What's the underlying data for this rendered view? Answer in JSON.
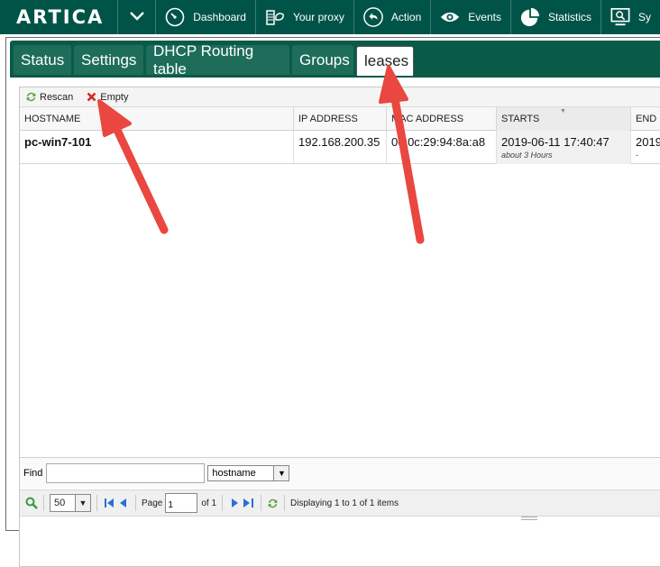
{
  "navbar": {
    "logo": "ARTICA",
    "items": [
      {
        "label": "Dashboard"
      },
      {
        "label": "Your proxy"
      },
      {
        "label": "Action"
      },
      {
        "label": "Events"
      },
      {
        "label": "Statistics"
      },
      {
        "label": "Sy"
      }
    ]
  },
  "tabs": [
    {
      "label": "Status"
    },
    {
      "label": "Settings"
    },
    {
      "label": "DHCP Routing table"
    },
    {
      "label": "Groups"
    },
    {
      "label": "leases",
      "active": true
    }
  ],
  "toolbar": {
    "rescan_label": "Rescan",
    "empty_label": "Empty"
  },
  "table": {
    "columns": [
      "HOSTNAME",
      "IP ADDRESS",
      "MAC ADDRESS",
      "STARTS",
      "END"
    ],
    "rows": [
      {
        "hostname": "pc-win7-101",
        "ip": "192.168.200.35",
        "mac": "00:0c:29:94:8a:a8",
        "starts": "2019-06-11 17:40:47",
        "starts_rel": "about 3 Hours",
        "end": "2019",
        "end_rel": "-"
      }
    ]
  },
  "find": {
    "label": "Find",
    "value": "",
    "field": "hostname"
  },
  "pager": {
    "per_page": "50",
    "page_label": "Page",
    "page": "1",
    "of_label": "of 1",
    "status": "Displaying 1 to 1 of 1 items"
  },
  "colors": {
    "navbar": "#005447",
    "tabbar": "#0a5a48",
    "arrow": "#e9473f"
  }
}
